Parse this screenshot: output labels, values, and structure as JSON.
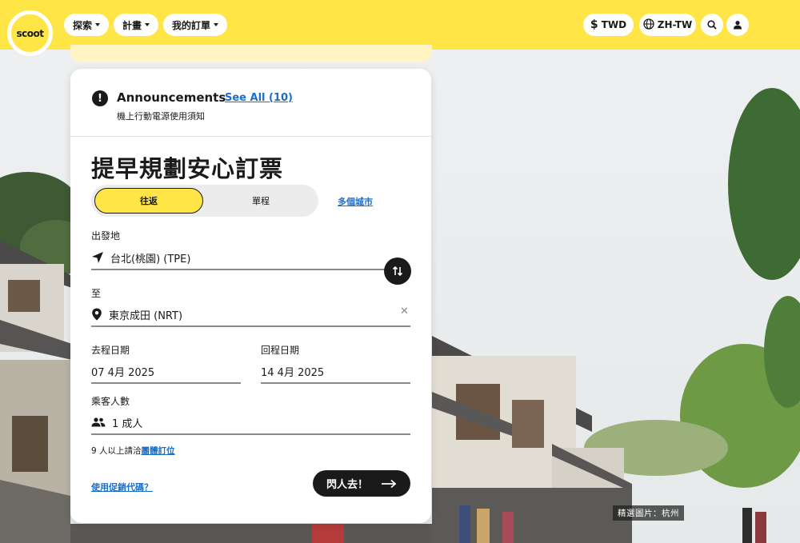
{
  "brand": {
    "logo_text": "scoot",
    "color": "#ffe546"
  },
  "nav": {
    "menus": [
      {
        "label": "探索"
      },
      {
        "label": "計畫"
      },
      {
        "label": "我的訂單"
      }
    ],
    "currency_label": "TWD",
    "language_label": "ZH-TW",
    "icons": [
      "dollar-icon",
      "globe-icon",
      "search-icon",
      "user-icon"
    ]
  },
  "announcements": {
    "title": "Announcements",
    "see_all_label": "See All (10)",
    "latest": "機上行動電源使用須知"
  },
  "booking": {
    "headline": "提早規劃安心訂票",
    "trip_types": {
      "round_trip": "往返",
      "one_way": "單程",
      "multi_city": "多個城市"
    },
    "origin_label": "出發地",
    "origin_value": "台北(桃園) (TPE)",
    "destination_label": "至",
    "destination_value": "東京成田 (NRT)",
    "clear_label": "✕",
    "depart_label": "去程日期",
    "depart_value": "07 4月 2025",
    "return_label": "回程日期",
    "return_value": "14 4月 2025",
    "passengers_label": "乘客人數",
    "passengers_value": "1 成人",
    "group_note_prefix": "9 人以上請洽",
    "group_note_link": "團體訂位",
    "promo_link": "使用促銷代碼？",
    "submit_label": "閃人去！"
  },
  "photo_caption": "精選圖片：杭州",
  "colors": {
    "accent_yellow": "#ffe546",
    "link_blue": "#1c6fc4",
    "dark": "#1a1a1a"
  }
}
